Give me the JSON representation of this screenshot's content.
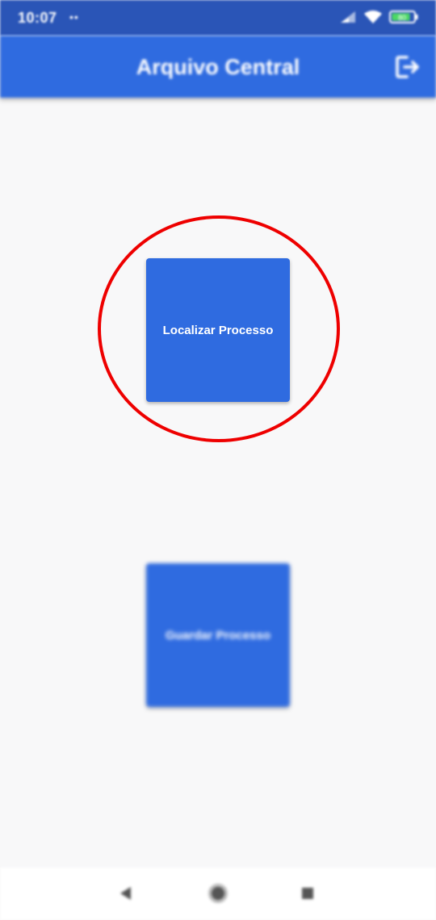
{
  "status_bar": {
    "time": "10:07",
    "notification_dots": "••",
    "battery_level": "80",
    "icons": [
      "signal-icon",
      "wifi-icon",
      "battery-icon"
    ]
  },
  "app_bar": {
    "title": "Arquivo Central",
    "action_icon": "logout-icon"
  },
  "main": {
    "tiles": [
      {
        "label": "Localizar Processo"
      },
      {
        "label": "Guardar Processo"
      }
    ],
    "highlight_color": "#ee0000"
  },
  "nav_bar": {
    "icons": [
      "back-icon",
      "home-icon",
      "recents-icon"
    ]
  },
  "colors": {
    "status_bar": "#2a55b7",
    "app_bar": "#2f6be0",
    "tile": "#2f6be0",
    "background": "#f8f8f9"
  }
}
